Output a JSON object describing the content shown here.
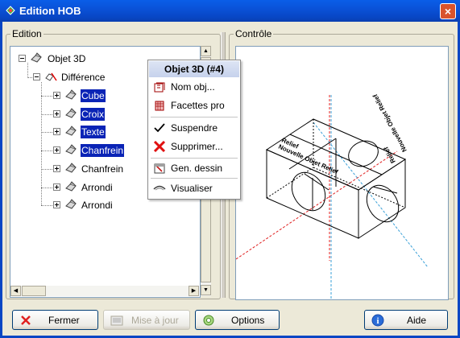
{
  "window": {
    "title": "Edition HOB",
    "close_label": "×"
  },
  "edition": {
    "group_label": "Edition",
    "tree": [
      {
        "label": "Objet 3D",
        "icon": "object-3d-icon",
        "selected": false
      },
      {
        "label": "Différence",
        "icon": "difference-icon",
        "selected": false
      },
      {
        "label": "Cube",
        "icon": "object-3d-icon",
        "selected": true
      },
      {
        "label": "Croix",
        "icon": "object-3d-icon",
        "selected": true
      },
      {
        "label": "Texte",
        "icon": "object-3d-icon",
        "selected": true
      },
      {
        "label": "Chanfrein",
        "icon": "object-3d-icon",
        "selected": true
      },
      {
        "label": "Chanfrein",
        "icon": "object-3d-icon",
        "selected": false
      },
      {
        "label": "Arrondi",
        "icon": "object-3d-icon",
        "selected": false
      },
      {
        "label": "Arrondi",
        "icon": "object-3d-icon",
        "selected": false
      }
    ]
  },
  "controle": {
    "group_label": "Contrôle",
    "engraved_text": [
      "Relief",
      "Nouvelle Objet Relief",
      "Relief",
      "Nouvelle Objet Relief"
    ]
  },
  "context_menu": {
    "header": "Objet 3D (#4)",
    "items": [
      {
        "label": "Nom obj...",
        "icon": "name-object-icon"
      },
      {
        "label": "Facettes pro",
        "icon": "facets-icon"
      },
      {
        "label": "Suspendre",
        "icon": "checkmark-icon"
      },
      {
        "label": "Supprimer...",
        "icon": "delete-x-icon"
      },
      {
        "label": "Gen. dessin",
        "icon": "generate-drawing-icon"
      },
      {
        "label": "Visualiser",
        "icon": "eye-icon"
      }
    ]
  },
  "buttons": {
    "close": "Fermer",
    "update": "Mise à jour",
    "options": "Options",
    "help": "Aide"
  },
  "colors": {
    "selection": "#0a24b6",
    "titlebar": "#0a52d8",
    "axis_red": "#e02020",
    "axis_cyan": "#3aa0d8"
  }
}
